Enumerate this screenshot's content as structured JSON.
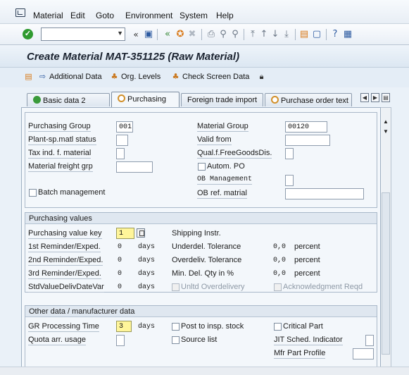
{
  "menu": {
    "items": [
      "Material",
      "Edit",
      "Goto",
      "Environment",
      "System",
      "Help"
    ]
  },
  "toolbar": {
    "command_field_value": "",
    "back_label": "«"
  },
  "title": "Create Material MAT-351125 (Raw Material)",
  "app_toolbar": {
    "additional_data": "Additional Data",
    "org_levels": "Org. Levels",
    "check_screen_data": "Check Screen Data"
  },
  "tabs": [
    {
      "label": "Basic data 2"
    },
    {
      "label": "Purchasing"
    },
    {
      "label": "Foreign trade import"
    },
    {
      "label": "Purchase order text"
    }
  ],
  "general": {
    "purchasing_group_label": "Purchasing Group",
    "purchasing_group_value": "001",
    "plant_status_label": "Plant-sp.matl status",
    "plant_status_value": "",
    "tax_ind_label": "Tax ind. f. material",
    "tax_ind_value": "",
    "freight_grp_label": "Material freight grp",
    "freight_grp_value": "",
    "batch_mgmt_label": "Batch management",
    "material_group_label": "Material Group",
    "material_group_value": "00120",
    "valid_from_label": "Valid from",
    "valid_from_value": "",
    "qual_free_goods_label": "Qual.f.FreeGoodsDis.",
    "qual_free_goods_value": "",
    "autom_po_label": "Autom. PO",
    "ob_management_label": "OB Management",
    "ob_management_value": "",
    "ob_ref_label": "OB ref. matrial",
    "ob_ref_value": ""
  },
  "purchasing_values": {
    "header": "Purchasing values",
    "value_key_label": "Purchasing value key",
    "value_key": "1",
    "shipping_instr_label": "Shipping Instr.",
    "rem1_label": "1st Reminder/Exped.",
    "rem1_value": "0",
    "rem2_label": "2nd Reminder/Exped.",
    "rem2_value": "0",
    "rem3_label": "3rd Reminder/Exped.",
    "rem3_value": "0",
    "std_value_label": "StdValueDelivDateVar",
    "std_value": "0",
    "days": "days",
    "underdel_label": "Underdel. Tolerance",
    "underdel_value": "0,0",
    "overdel_label": "Overdeliv. Tolerance",
    "overdel_value": "0,0",
    "min_del_label": "Min. Del. Qty in %",
    "min_del_value": "0,0",
    "percent": "percent",
    "unltd_overdelivery_label": "Unltd Overdelivery",
    "acknowledgment_label": "Acknowledgment Reqd"
  },
  "other_data": {
    "header": "Other data / manufacturer data",
    "gr_time_label": "GR Processing Time",
    "gr_time_value": "3",
    "days": "days",
    "quota_label": "Quota arr. usage",
    "quota_value": "",
    "post_insp_label": "Post to insp. stock",
    "source_list_label": "Source list",
    "critical_part_label": "Critical Part",
    "jit_label": "JIT Sched. Indicator",
    "jit_value": "",
    "mfr_profile_label": "Mfr Part Profile",
    "mfr_profile_value": ""
  }
}
